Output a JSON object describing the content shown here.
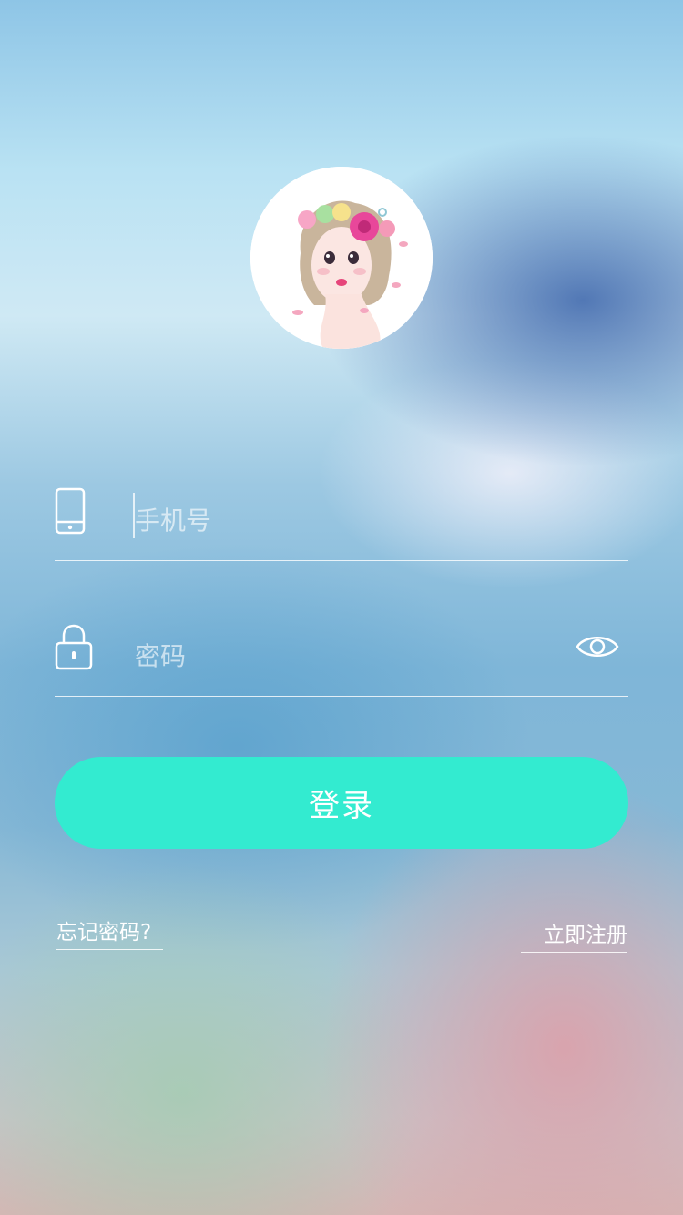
{
  "colors": {
    "accent": "#33ebd0",
    "text": "#ffffff"
  },
  "avatar": {
    "description": "user-avatar-illustration"
  },
  "phone_field": {
    "icon": "mobile-phone-icon",
    "placeholder": "手机号",
    "value": ""
  },
  "password_field": {
    "icon": "lock-icon",
    "placeholder": "密码",
    "value": "",
    "toggle_icon": "eye-icon"
  },
  "login_button": {
    "label": "登录"
  },
  "links": {
    "forgot_password": "忘记密码?",
    "register": "立即注册"
  }
}
